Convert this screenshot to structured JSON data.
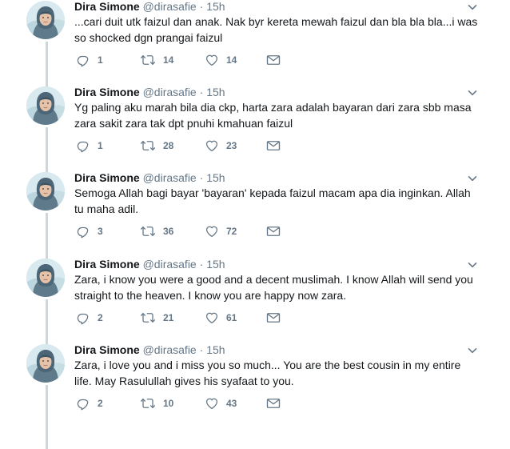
{
  "tweets": [
    {
      "name": "Dira Simone",
      "handle": "@dirasafie",
      "dot": "·",
      "time": "15h",
      "text_lines": [
        "...cari duit utk faizul dan anak. Nak byr kereta mewah faizul dan bla bla bla...i was",
        "so shocked dgn prangai faizul"
      ],
      "replies": "1",
      "retweets": "14",
      "likes": "14"
    },
    {
      "name": "Dira Simone",
      "handle": "@dirasafie",
      "dot": "·",
      "time": "15h",
      "text_lines": [
        "Yg paling aku marah bila dia ckp, harta zara adalah bayaran dari zara sbb masa",
        "zara sakit zara tak dpt pnuhi kmahuan faizul"
      ],
      "replies": "1",
      "retweets": "28",
      "likes": "23"
    },
    {
      "name": "Dira Simone",
      "handle": "@dirasafie",
      "dot": "·",
      "time": "15h",
      "text_lines": [
        "Semoga Allah bagi bayar 'bayaran' kepada faizul macam apa dia inginkan. Allah",
        "tu maha adil."
      ],
      "replies": "3",
      "retweets": "36",
      "likes": "72"
    },
    {
      "name": "Dira Simone",
      "handle": "@dirasafie",
      "dot": "·",
      "time": "15h",
      "text_lines": [
        "Zara, i know you were a good and a decent muslimah. I know Allah will send you",
        "straight to the heaven. I know you are happy now zara."
      ],
      "replies": "2",
      "retweets": "21",
      "likes": "61"
    },
    {
      "name": "Dira Simone",
      "handle": "@dirasafie",
      "dot": "·",
      "time": "15h",
      "text_lines": [
        "Zara, i love you and i miss you so much... You are the best cousin in my entire",
        "life. May Rasulullah gives his syafaat to you."
      ],
      "replies": "2",
      "retweets": "10",
      "likes": "43"
    }
  ],
  "icons": {
    "reply": "reply-icon",
    "retweet": "retweet-icon",
    "like": "heart-icon",
    "message": "envelope-icon",
    "caret": "chevron-down-icon"
  },
  "colors": {
    "text": "#14171a",
    "muted": "#657786",
    "thread_line": "#ccd6dd"
  }
}
